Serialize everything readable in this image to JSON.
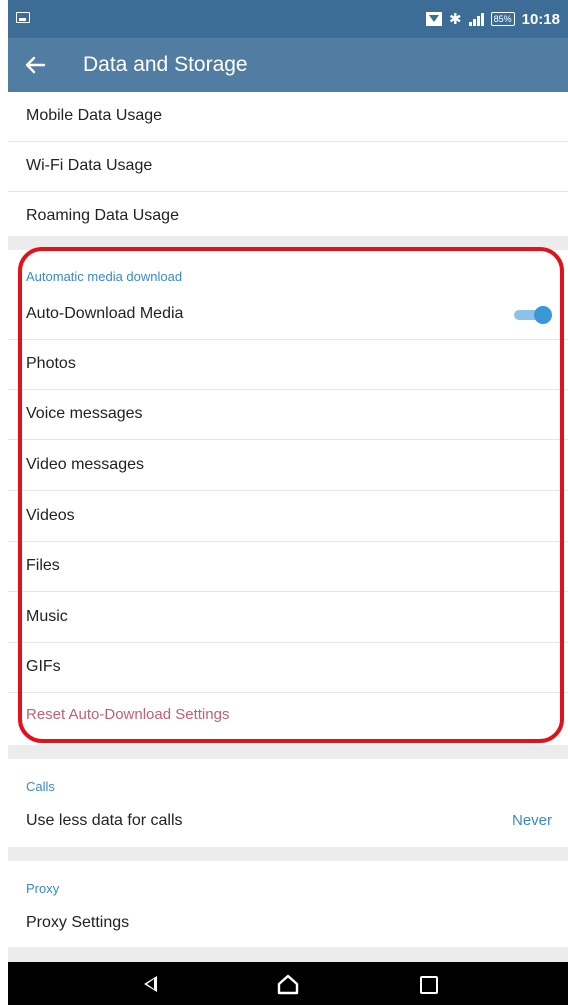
{
  "status_bar": {
    "time": "10:18",
    "battery": "85%"
  },
  "app_bar": {
    "title": "Data and Storage"
  },
  "usage_section": {
    "items": [
      {
        "label": "Mobile Data Usage"
      },
      {
        "label": "Wi-Fi Data Usage"
      },
      {
        "label": "Roaming Data Usage"
      }
    ]
  },
  "auto_download": {
    "header": "Automatic media download",
    "toggle_label": "Auto-Download Media",
    "toggle_on": true,
    "items": [
      {
        "label": "Photos"
      },
      {
        "label": "Voice messages"
      },
      {
        "label": "Video messages"
      },
      {
        "label": "Videos"
      },
      {
        "label": "Files"
      },
      {
        "label": "Music"
      },
      {
        "label": "GIFs"
      }
    ],
    "reset_label": "Reset Auto-Download Settings"
  },
  "calls": {
    "header": "Calls",
    "label": "Use less data for calls",
    "value": "Never"
  },
  "proxy": {
    "header": "Proxy",
    "label": "Proxy Settings"
  },
  "colors": {
    "status_bar": "#3d6c97",
    "app_bar": "#527da3",
    "accent": "#3a8ac5",
    "highlight": "#e0131c",
    "reset": "#c06070"
  }
}
